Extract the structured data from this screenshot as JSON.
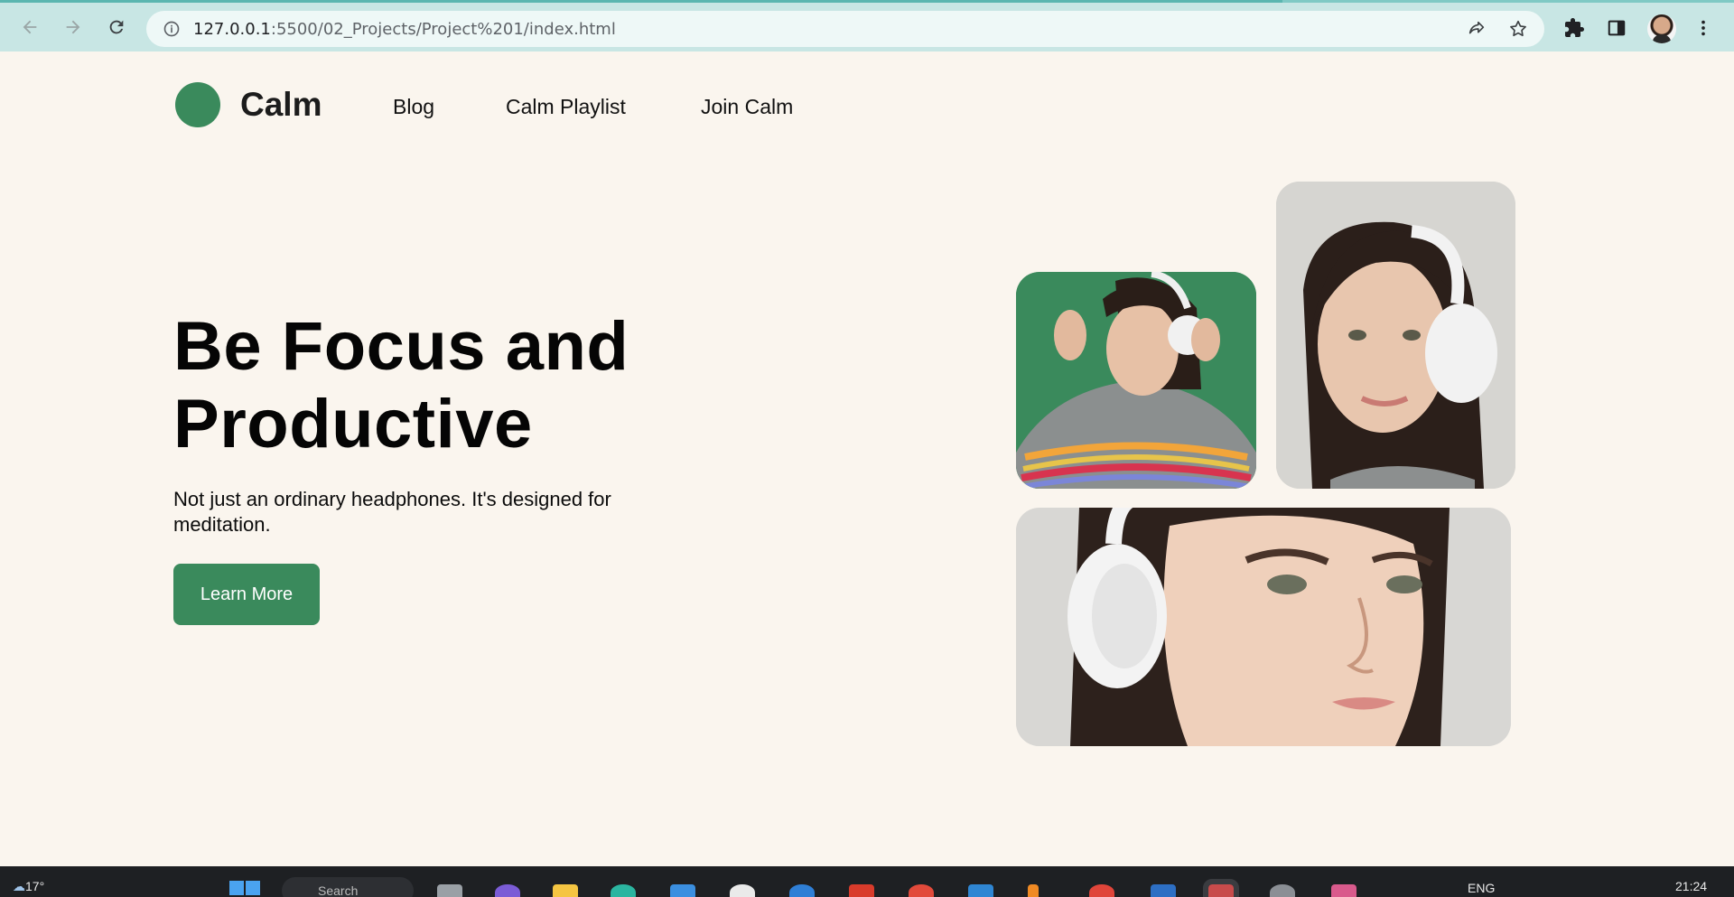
{
  "browser": {
    "url_host": "127.0.0.1",
    "url_rest": ":5500/02_Projects/Project%201/index.html",
    "back_icon": "arrow-left-icon",
    "forward_icon": "arrow-right-icon",
    "reload_icon": "reload-icon",
    "share_icon": "share-icon",
    "star_icon": "star-icon",
    "extensions_icon": "puzzle-icon",
    "sidepanel_icon": "side-panel-icon",
    "menu_icon": "kebab-menu-icon"
  },
  "site": {
    "brand": "Calm",
    "nav": [
      "Blog",
      "Calm Playlist",
      "Join Calm"
    ],
    "hero": {
      "title_line1": "Be Focus and",
      "title_line2": "Productive",
      "subtitle": "Not just an ordinary headphones. It's designed for meditation.",
      "cta_label": "Learn More"
    },
    "colors": {
      "accent": "#3a8a5c",
      "background": "#faf5ee"
    }
  },
  "taskbar": {
    "temperature": "17°",
    "search_label": "Search",
    "language": "ENG",
    "time": "21:24"
  }
}
